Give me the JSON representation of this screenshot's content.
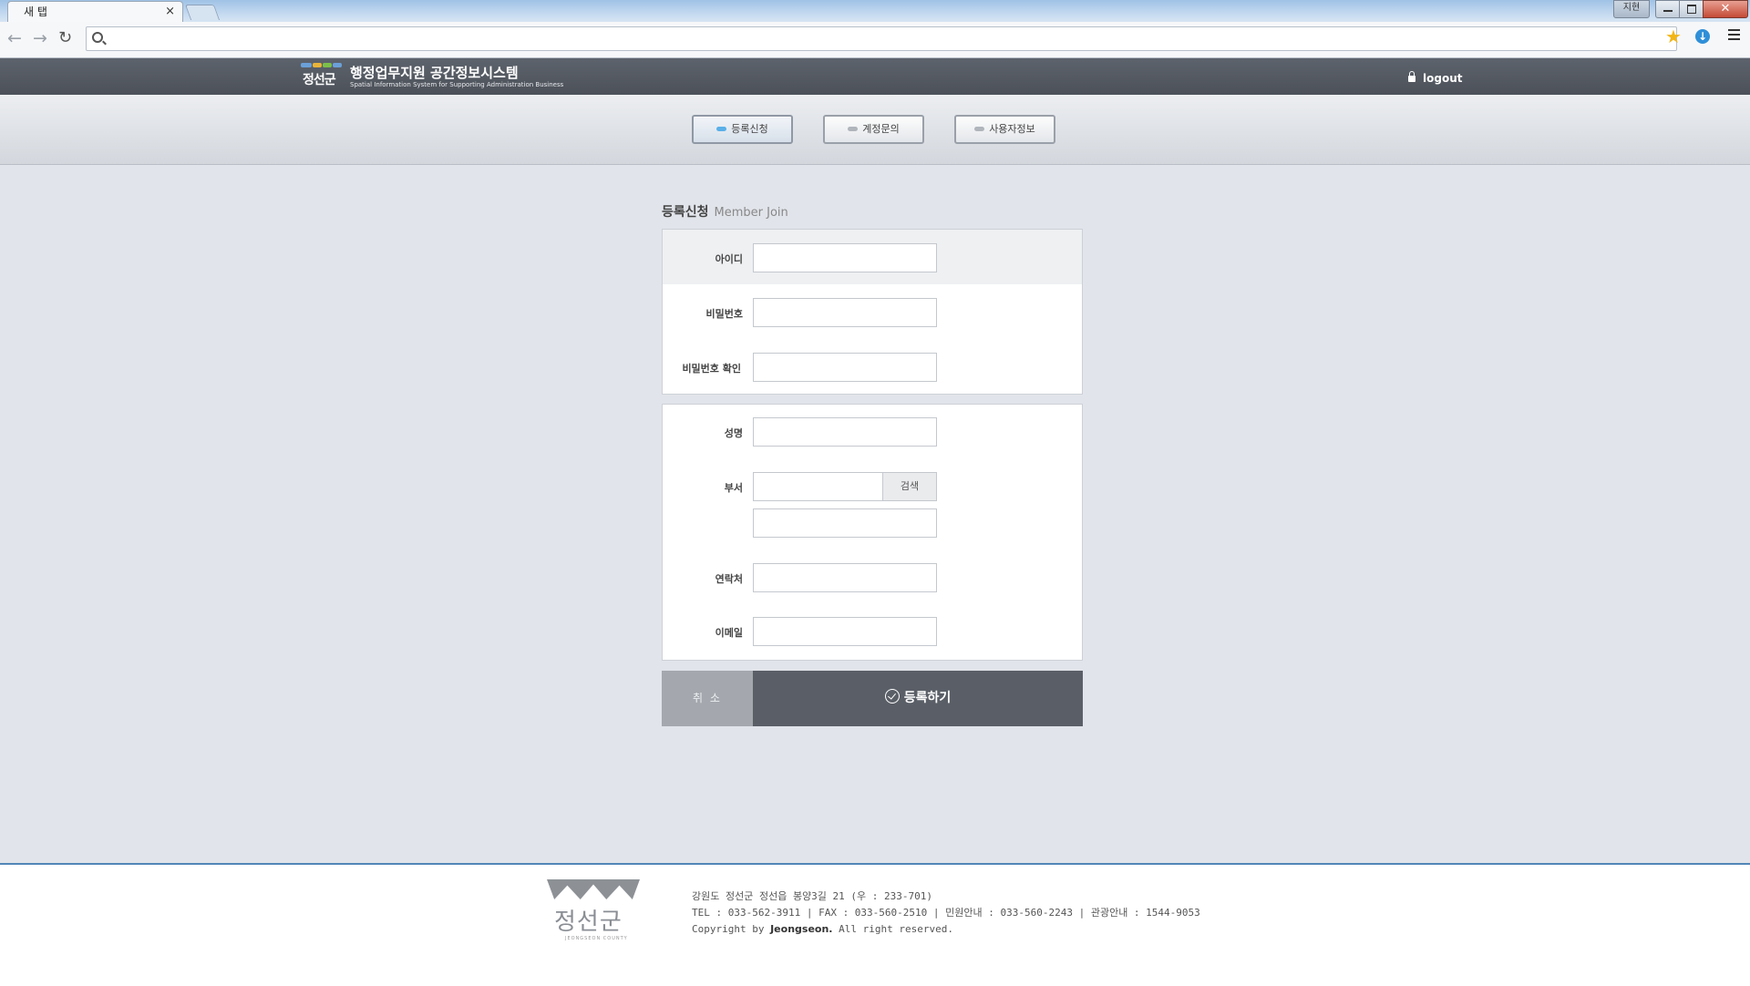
{
  "browser": {
    "tab_title": "새 탭",
    "tab_close": "×",
    "user_button": "지현",
    "close_label": "✕",
    "back_label": "←",
    "forward_label": "→",
    "reload_label": "C",
    "address_value": "",
    "bookmark_icon": "star-icon",
    "download_icon": "download-icon"
  },
  "header": {
    "logo_text": "정선군",
    "title": "행정업무지원 공간정보시스템",
    "subtitle": "Spatial Information System for Supporting Administration Business",
    "logout": "logout"
  },
  "subnav": {
    "items": [
      {
        "label": "등록신청",
        "active": true
      },
      {
        "label": "계정문의",
        "active": false
      },
      {
        "label": "사용자정보",
        "active": false
      }
    ]
  },
  "form": {
    "title": "등록신청",
    "title_en": "Member Join",
    "fields": {
      "id_label": "아이디",
      "password_label": "비밀번호",
      "password_confirm_label": "비밀번호 확인",
      "name_label": "성명",
      "department_label": "부서",
      "department_search": "검색",
      "contact_label": "연락처",
      "email_label": "이메일"
    },
    "cancel": "취 소",
    "submit": "등록하기"
  },
  "footer": {
    "logo_text": "정선군",
    "logo_sub": "JEONGSEON COUNTY",
    "address": "강원도 정선군 정선읍 봉양3길 21 (우 : 233-701)",
    "contacts": "TEL : 033-562-3911  |  FAX : 033-560-2510  |  민원안내 : 033-560-2243  |  관광안내 : 1544-9053",
    "copyright_prefix": "Copyright by ",
    "copyright_name": "Jeongseon.",
    "copyright_suffix": " All right reserved."
  },
  "colors": {
    "header_bg": "#565b63",
    "page_bg": "#e1e4ea",
    "submit_bg": "#5a5f67",
    "cancel_bg": "#a4a8ae",
    "footer_border": "#5186b8"
  }
}
